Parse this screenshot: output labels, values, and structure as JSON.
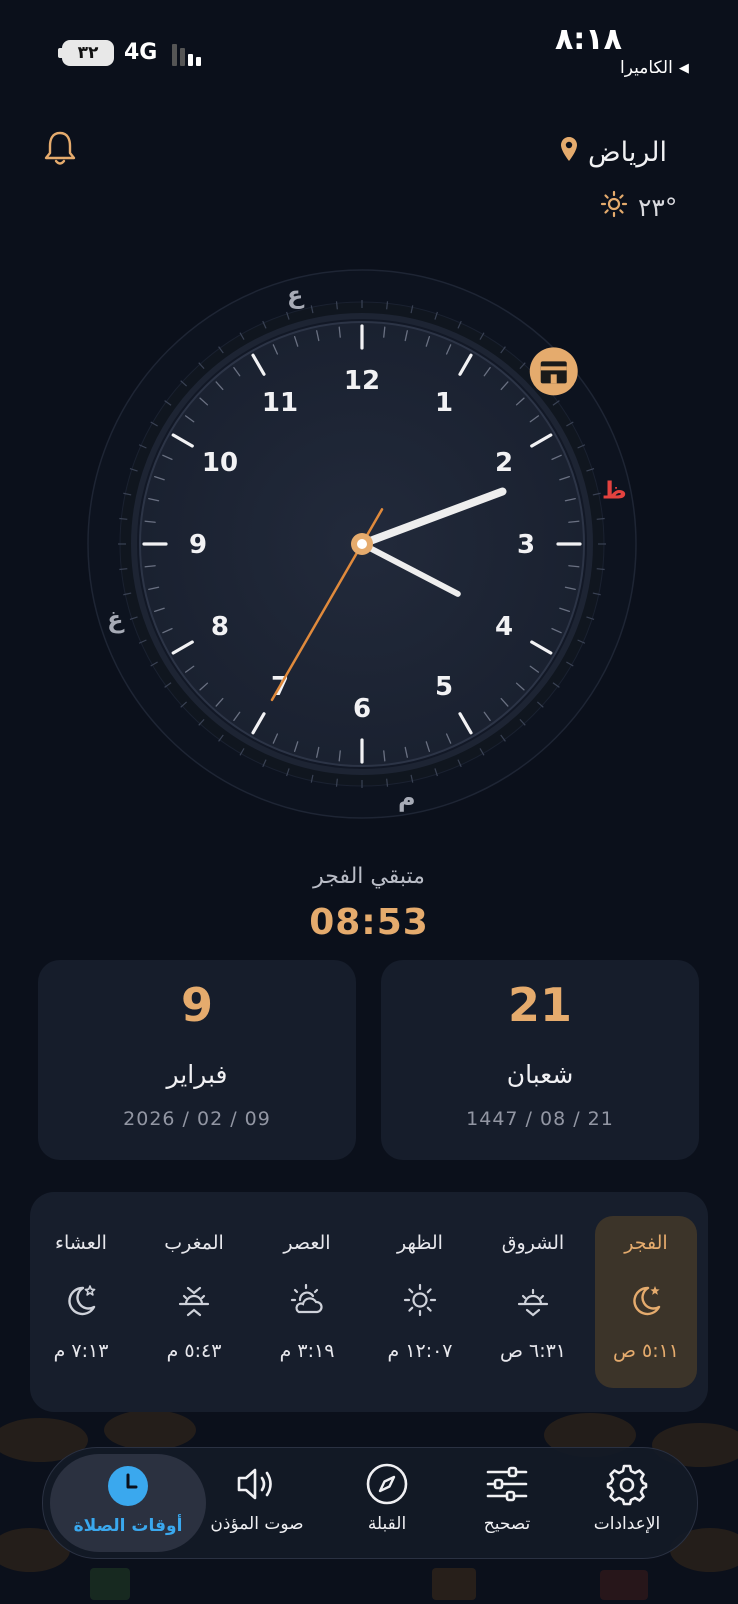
{
  "status_bar": {
    "time": "٨:١٨",
    "back_app": "الكاميرا",
    "battery": "٣٢",
    "network": "4G"
  },
  "header": {
    "city": "الرياض",
    "temperature": "°٢٣",
    "icons": {
      "notification": "bell-icon",
      "location": "location-pin-icon",
      "weather": "sun-icon"
    }
  },
  "clock": {
    "numbers": [
      "12",
      "1",
      "2",
      "3",
      "4",
      "5",
      "6",
      "7",
      "8",
      "9",
      "10",
      "11"
    ],
    "time_shown": "2:19:35",
    "ring_markers": [
      {
        "label": "ع",
        "angle_deg": -15
      },
      {
        "label": "ظ",
        "angle_deg": 78
      },
      {
        "label": "م",
        "angle_deg": 170
      },
      {
        "label": "غ",
        "angle_deg": 253
      }
    ],
    "kaaba_icon": "kaaba-icon"
  },
  "countdown": {
    "label": "متبقي الفجر",
    "value": "08:53"
  },
  "dates": {
    "hijri": {
      "day": "21",
      "month": "شعبان",
      "full": "1447 / 08 / 21"
    },
    "gregorian": {
      "day": "9",
      "month": "فبراير",
      "full": "2026 / 02 / 09"
    }
  },
  "prayers": [
    {
      "name": "الفجر",
      "time": "٥:١١ ص",
      "icon": "moon-star-icon",
      "active": true
    },
    {
      "name": "الشروق",
      "time": "٦:٣١ ص",
      "icon": "sunrise-icon",
      "active": false
    },
    {
      "name": "الظهر",
      "time": "١٢:٠٧ م",
      "icon": "sun-icon",
      "active": false
    },
    {
      "name": "العصر",
      "time": "٣:١٩ م",
      "icon": "sun-cloud-icon",
      "active": false
    },
    {
      "name": "المغرب",
      "time": "٥:٤٣ م",
      "icon": "sunset-icon",
      "active": false
    },
    {
      "name": "العشاء",
      "time": "٧:١٣ م",
      "icon": "moon-star-icon",
      "active": false
    }
  ],
  "nav": [
    {
      "label": "الإعدادات",
      "icon": "gear-icon"
    },
    {
      "label": "تصحيح",
      "icon": "sliders-icon"
    },
    {
      "label": "القبلة",
      "icon": "compass-icon"
    },
    {
      "label": "صوت المؤذن",
      "icon": "speaker-icon"
    },
    {
      "label": "أوقات الصلاة",
      "icon": "clock-icon",
      "active": true
    }
  ],
  "colors": {
    "background": "#0b101b",
    "accent": "#e5ab6d",
    "active_tab": "#3aa8ee",
    "card": "#161d2b"
  }
}
